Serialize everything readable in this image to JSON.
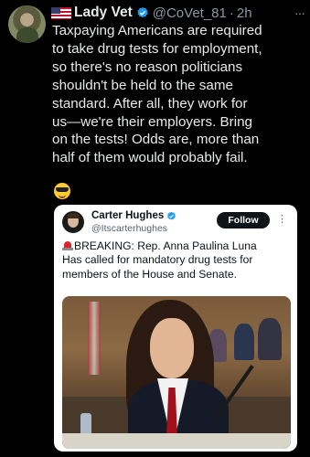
{
  "tweet": {
    "author_name": "Lady Vet",
    "handle": "@CoVet_81",
    "separator": "·",
    "time": "2h",
    "more": "···",
    "text": "Taxpaying Americans are required\nto take drug tests for employment,\nso there's no reason politicians\nshouldn't be held to the same\nstandard. After all, they work for\nus—we're their employers. Bring\non the tests! Odds are, more than\nhalf of them would probably fail.",
    "emoji": "sunglasses-face-emoji"
  },
  "quoted": {
    "author_name": "Carter Hughes",
    "handle": "@Itscarterhughes",
    "follow_label": "Follow",
    "more": "⋮",
    "text": "BREAKING: Rep. Anna Paulina Luna\nHas called for mandatory drug tests for\nmembers of the House and Senate.",
    "icons": [
      "siren-emoji",
      "verified-badge"
    ]
  },
  "colors": {
    "background": "#000000",
    "text": "#e7e9ea",
    "muted": "#8b98a5",
    "verified": "#1d9bf0",
    "card_bg": "#ffffff"
  }
}
